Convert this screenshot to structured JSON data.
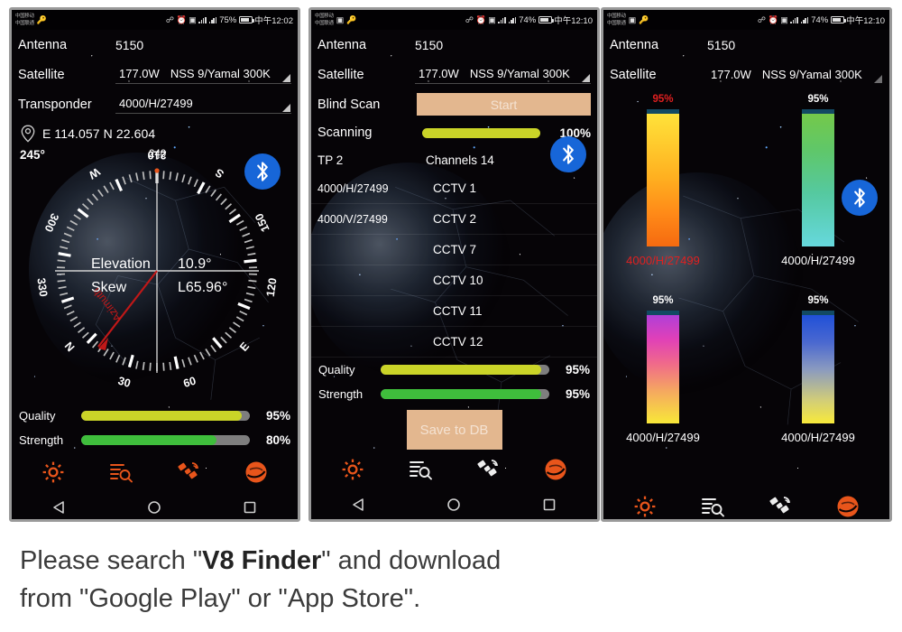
{
  "caption": {
    "line1_a": "Please search \"",
    "line1_b": "V8 Finder",
    "line1_c": "\" and download",
    "line2": "from \"Google Play\" or \"App Store\"."
  },
  "status_bar": {
    "carrier_line1": "中国移动",
    "carrier_line2": "中国联通",
    "battery_1": "75%",
    "battery_2": "74%",
    "time_1": "中午12:02",
    "time_2": "中午12:10",
    "time_3": "中午12:10"
  },
  "phone1": {
    "antenna_label": "Antenna",
    "antenna_value": "5150",
    "satellite_label": "Satellite",
    "satellite_position": "177.0W",
    "satellite_name": "NSS 9/Yamal 300K",
    "transponder_label": "Transponder",
    "transponder_value": "4000/H/27499",
    "gps": "E 114.057 N 22.604",
    "heading": "245°",
    "compass_top_label": "240",
    "compass_ticks": [
      "210",
      "S",
      "150",
      "120",
      "E",
      "60",
      "30",
      "N",
      "330",
      "300",
      "W"
    ],
    "elevation_label": "Elevation",
    "elevation_value": "10.9°",
    "skew_label": "Skew",
    "skew_value": "L65.96°",
    "azimuth_label": "Azimuth",
    "quality_label": "Quality",
    "quality_pct": "95%",
    "quality_value": 95,
    "strength_label": "Strength",
    "strength_pct": "80%",
    "strength_value": 80
  },
  "phone2": {
    "antenna_label": "Antenna",
    "antenna_value": "5150",
    "satellite_label": "Satellite",
    "satellite_position": "177.0W",
    "satellite_name": "NSS 9/Yamal 300K",
    "blind_scan_label": "Blind Scan",
    "start_button": "Start",
    "scanning_label": "Scanning",
    "scanning_pct": "100%",
    "scanning_value": 100,
    "tp_label": "TP 2",
    "channels_label": "Channels 14",
    "channels": [
      {
        "tp": "4000/H/27499",
        "name": "CCTV 1"
      },
      {
        "tp": "4000/V/27499",
        "name": "CCTV 2"
      },
      {
        "tp": "",
        "name": "CCTV 7"
      },
      {
        "tp": "",
        "name": "CCTV 10"
      },
      {
        "tp": "",
        "name": "CCTV 11"
      },
      {
        "tp": "",
        "name": "CCTV 12"
      }
    ],
    "quality_label": "Quality",
    "quality_pct": "95%",
    "quality_value": 95,
    "strength_label": "Strength",
    "strength_pct": "95%",
    "strength_value": 95,
    "save_button": "Save to DB"
  },
  "phone3": {
    "antenna_label": "Antenna",
    "antenna_value": "5150",
    "satellite_label": "Satellite",
    "satellite_position": "177.0W",
    "satellite_name": "NSS 9/Yamal 300K",
    "meters": [
      {
        "pct": "95%",
        "label": "4000/H/27499",
        "pct_color": "#e02020",
        "label_color": "#e02020",
        "gradient": "linear-gradient(180deg,#ffe23a 0%,#ffd030 18%,#ffb020 48%,#ff8a18 75%,#f56a10 100%)"
      },
      {
        "pct": "95%",
        "label": "4000/H/27499",
        "pct_color": "#ffffff",
        "label_color": "#ffffff",
        "gradient": "linear-gradient(180deg,#74c94a 0%,#5fc76a 28%,#55c9a0 60%,#66d8dd 100%)"
      },
      {
        "pct": "95%",
        "label": "4000/H/27499",
        "pct_color": "#ffffff",
        "label_color": "#ffffff",
        "gradient": "linear-gradient(180deg,#b03fd8 0%,#e040b8 22%,#f06a8a 45%,#f5a860 70%,#f8e838 100%)"
      },
      {
        "pct": "95%",
        "label": "4000/H/27499",
        "pct_color": "#ffffff",
        "label_color": "#ffffff",
        "gradient": "linear-gradient(180deg,#2050d8 0%,#4a68d0 25%,#8a9ac0 50%,#d0cc7a 78%,#f8ea3a 100%)"
      }
    ]
  },
  "tabbar": {
    "settings_icon": "gear-icon",
    "scan_icon": "list-search-icon",
    "satellite_icon": "satellite-icon",
    "globe_icon": "globe-icon",
    "back_icon": "nav-back-icon",
    "home_icon": "nav-home-icon",
    "recents_icon": "nav-recents-icon"
  },
  "colors": {
    "accent_orange": "#e8551b",
    "bluetooth_blue": "#1766d8",
    "quality_yellow": "#cad428",
    "strength_green": "#3fbe3c",
    "track_gray": "#7e7e7e",
    "button_tan": "#e3b78f"
  }
}
